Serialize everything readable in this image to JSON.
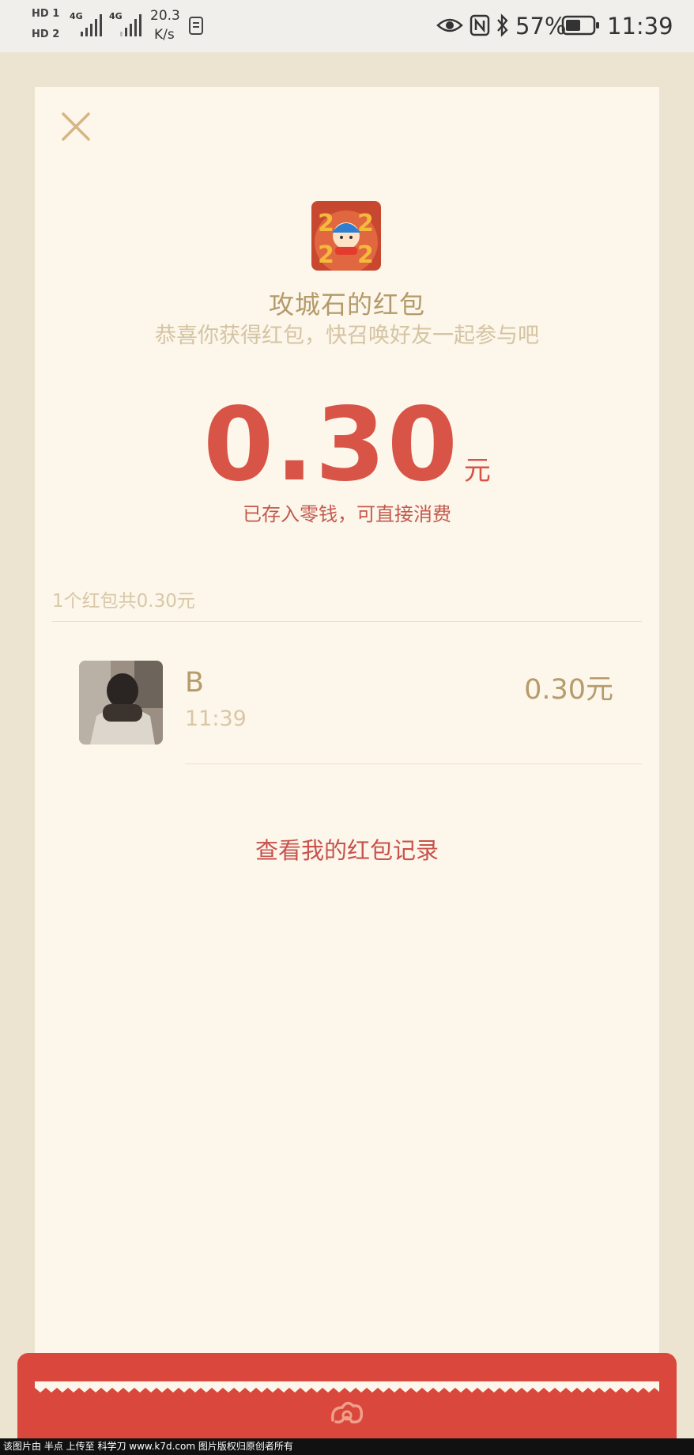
{
  "status_bar": {
    "sim1": "HD 1",
    "sim2": "HD 2",
    "network1": "4G",
    "network2": "4G",
    "speed_value": "20.3",
    "speed_unit": "K/s",
    "battery": "57%",
    "time": "11:39",
    "icons": [
      "sim-hd-icon",
      "signal-icon",
      "document-icon",
      "eye-icon",
      "nfc-icon",
      "bluetooth-icon",
      "battery-icon"
    ]
  },
  "card": {
    "sender_title": "攻城石的红包",
    "subtitle": "恭喜你获得红包，快召唤好友一起参与吧",
    "amount": "0.30",
    "unit": "元",
    "stored_note": "已存入零钱，可直接消费",
    "summary": "1个红包共0.30元",
    "records": [
      {
        "name": "B",
        "time": "11:39",
        "amount": "0.30元"
      }
    ],
    "history_link": "查看我的红包记录"
  },
  "watermark": "该图片由 半点 上传至 科学刀 www.k7d.com 图片版权归原创者所有",
  "colors": {
    "background": "#ece3d1",
    "card": "#fcf6eb",
    "accent_red": "#d75447",
    "gold_text": "#b49a6a",
    "bottom_bar": "#d9473d"
  }
}
